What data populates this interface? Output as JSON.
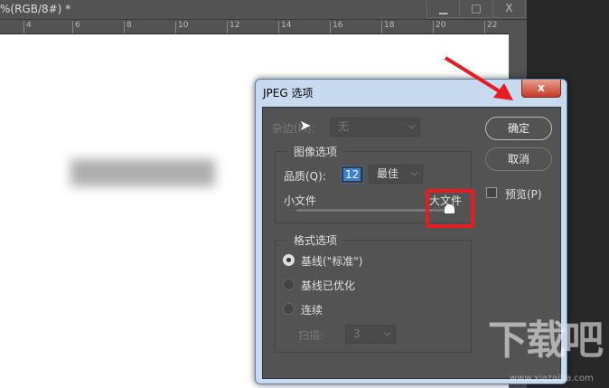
{
  "document": {
    "title": "%(RGB/8#) *",
    "window_buttons": [
      "minimize",
      "maximize",
      "close"
    ],
    "window_glyphs": [
      "▁",
      "□",
      "X"
    ]
  },
  "ruler": {
    "ticks": [
      "4",
      "6",
      "8",
      "10",
      "12",
      "14",
      "16",
      "18",
      "20",
      "22"
    ]
  },
  "dialog": {
    "title": "JPEG 选项",
    "close_label": "x",
    "matte_label": "杂边(M):",
    "matte_value": "无",
    "image_options": {
      "title": "图像选项",
      "quality_label": "品质(Q):",
      "quality_value": "12",
      "quality_preset": "最佳",
      "small_file": "小文件",
      "large_file": "大文件",
      "quality_fraction": 1.0
    },
    "format_options": {
      "title": "格式选项",
      "options": [
        "基线(\"标准\")",
        "基线已优化",
        "连续"
      ],
      "selected": 0,
      "scans_label": "扫描:",
      "scans_value": "3"
    },
    "ok_label": "确定",
    "cancel_label": "取消",
    "preview_label": "预览(P)",
    "preview_checked": false
  },
  "watermark": {
    "logo": "下载吧",
    "url": "www.xiazaiba.com"
  },
  "colors": {
    "annotation": "#e81b23",
    "panel": "#535353"
  }
}
